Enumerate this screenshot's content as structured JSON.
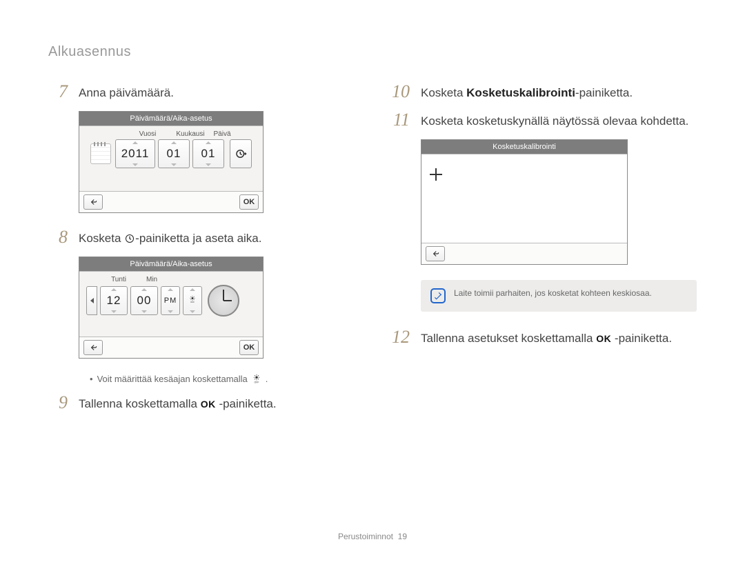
{
  "section_title": "Alkuasennus",
  "left": {
    "step7": {
      "num": "7",
      "text": "Anna päivämäärä."
    },
    "step8": {
      "num": "8",
      "text_before": "Kosketa ",
      "text_after": "-painiketta ja aseta aika."
    },
    "step9": {
      "num": "9",
      "text_before": "Tallenna koskettamalla ",
      "ok": "OK",
      "text_after": " -painiketta."
    },
    "bullet": {
      "text_before": "Voit määrittää kesäajan koskettamalla ",
      "text_after": "."
    }
  },
  "right": {
    "step10": {
      "num": "10",
      "text_before": "Kosketa ",
      "bold": "Kosketuskalibrointi",
      "text_after": "-painiketta."
    },
    "step11": {
      "num": "11",
      "text": "Kosketa kosketuskynällä näytössä olevaa kohdetta."
    },
    "step12": {
      "num": "12",
      "text_before": "Tallenna asetukset koskettamalla ",
      "ok": "OK",
      "text_after": " -painiketta."
    }
  },
  "date_screen": {
    "title": "Päivämäärä/Aika-asetus",
    "labels": {
      "year": "Vuosi",
      "month": "Kuukausi",
      "day": "Päivä"
    },
    "values": {
      "year": "2011",
      "month": "01",
      "day": "01"
    },
    "ok": "OK"
  },
  "time_screen": {
    "title": "Päivämäärä/Aika-asetus",
    "labels": {
      "hour": "Tunti",
      "min": "Min"
    },
    "values": {
      "hour": "12",
      "min": "00",
      "ampm": "PM"
    },
    "ok": "OK"
  },
  "calib_screen": {
    "title": "Kosketuskalibrointi"
  },
  "info_text": "Laite toimii parhaiten, jos kosketat kohteen keskiosaa.",
  "footer": {
    "label": "Perustoiminnot",
    "page": "19"
  }
}
